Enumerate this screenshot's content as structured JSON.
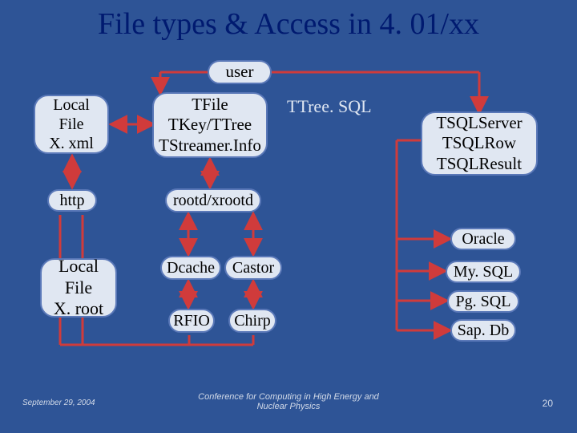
{
  "title": "File types & Access in 4. 01/xx",
  "nodes": {
    "user": "user",
    "localxml": "Local\nFile\nX. xml",
    "tfile": "TFile\nTKey/TTree\nTStreamer.Info",
    "ttreesql": "TTree. SQL",
    "tsqlsrv": "TSQLServer\nTSQLRow\nTSQLResult",
    "http": "http",
    "rootd": "rootd/xrootd",
    "localroot": "Local\nFile\nX. root",
    "dcache": "Dcache",
    "castor": "Castor",
    "rfio": "RFIO",
    "chirp": "Chirp",
    "oracle": "Oracle",
    "mysql": "My. SQL",
    "pgsql": "Pg. SQL",
    "sapdb": "Sap. Db"
  },
  "footer": {
    "date": "September 29, 2004",
    "conf": "Conference for Computing in High Energy and\nNuclear Physics",
    "page": "20"
  }
}
